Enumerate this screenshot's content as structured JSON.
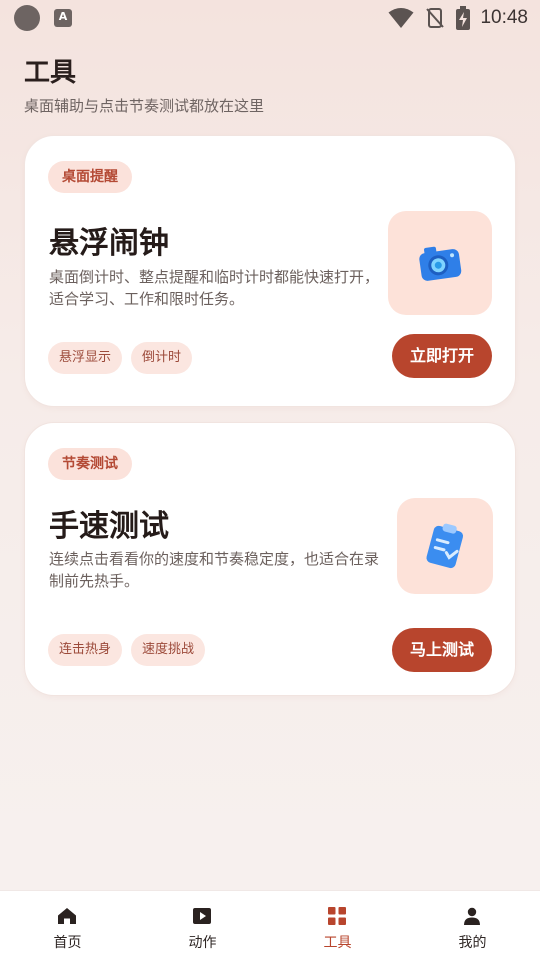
{
  "status_bar": {
    "time": "10:48",
    "app_icon_letter": "A"
  },
  "header": {
    "title": "工具",
    "subtitle": "桌面辅助与点击节奏测试都放在这里"
  },
  "cards": [
    {
      "badge": "桌面提醒",
      "title": "悬浮闹钟",
      "description": "桌面倒计时、整点提醒和临时计时都能快速打开，适合学习、工作和限时任务。",
      "icon": "camera-icon",
      "tags": [
        "悬浮显示",
        "倒计时"
      ],
      "action_label": "立即打开"
    },
    {
      "badge": "节奏测试",
      "title": "手速测试",
      "description": "连续点击看看你的速度和节奏稳定度，也适合在录制前先热手。",
      "icon": "clipboard-icon",
      "tags": [
        "连击热身",
        "速度挑战"
      ],
      "action_label": "马上测试"
    }
  ],
  "bottom_nav": {
    "items": [
      {
        "label": "首页",
        "icon": "home-icon"
      },
      {
        "label": "动作",
        "icon": "play-icon"
      },
      {
        "label": "工具",
        "icon": "grid-icon"
      },
      {
        "label": "我的",
        "icon": "person-icon"
      }
    ],
    "active_index": 2
  },
  "colors": {
    "accent": "#b8452d",
    "badge_bg": "#fbe2db",
    "chip_bg": "#fbe6e0",
    "tile_bg": "#fde2d9"
  }
}
